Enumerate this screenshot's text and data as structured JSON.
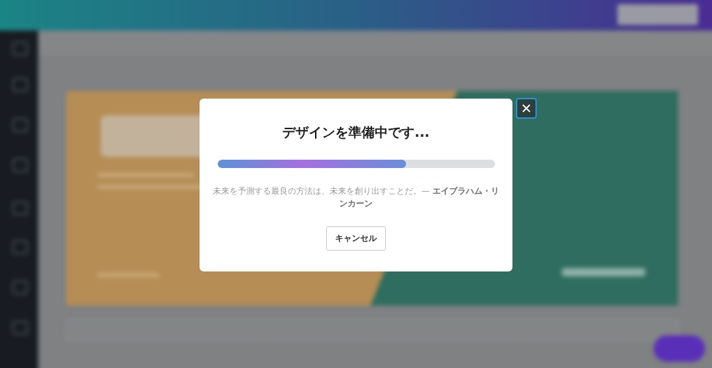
{
  "dialog": {
    "title": "デザインを準備中です...",
    "progress": {
      "level": 0.68
    },
    "quote": "未来を予測する最良の方法は、未来を創り出すことだ。— **エイブラハム・リンカーン**",
    "cancel_button": "キャンセル"
  }
}
